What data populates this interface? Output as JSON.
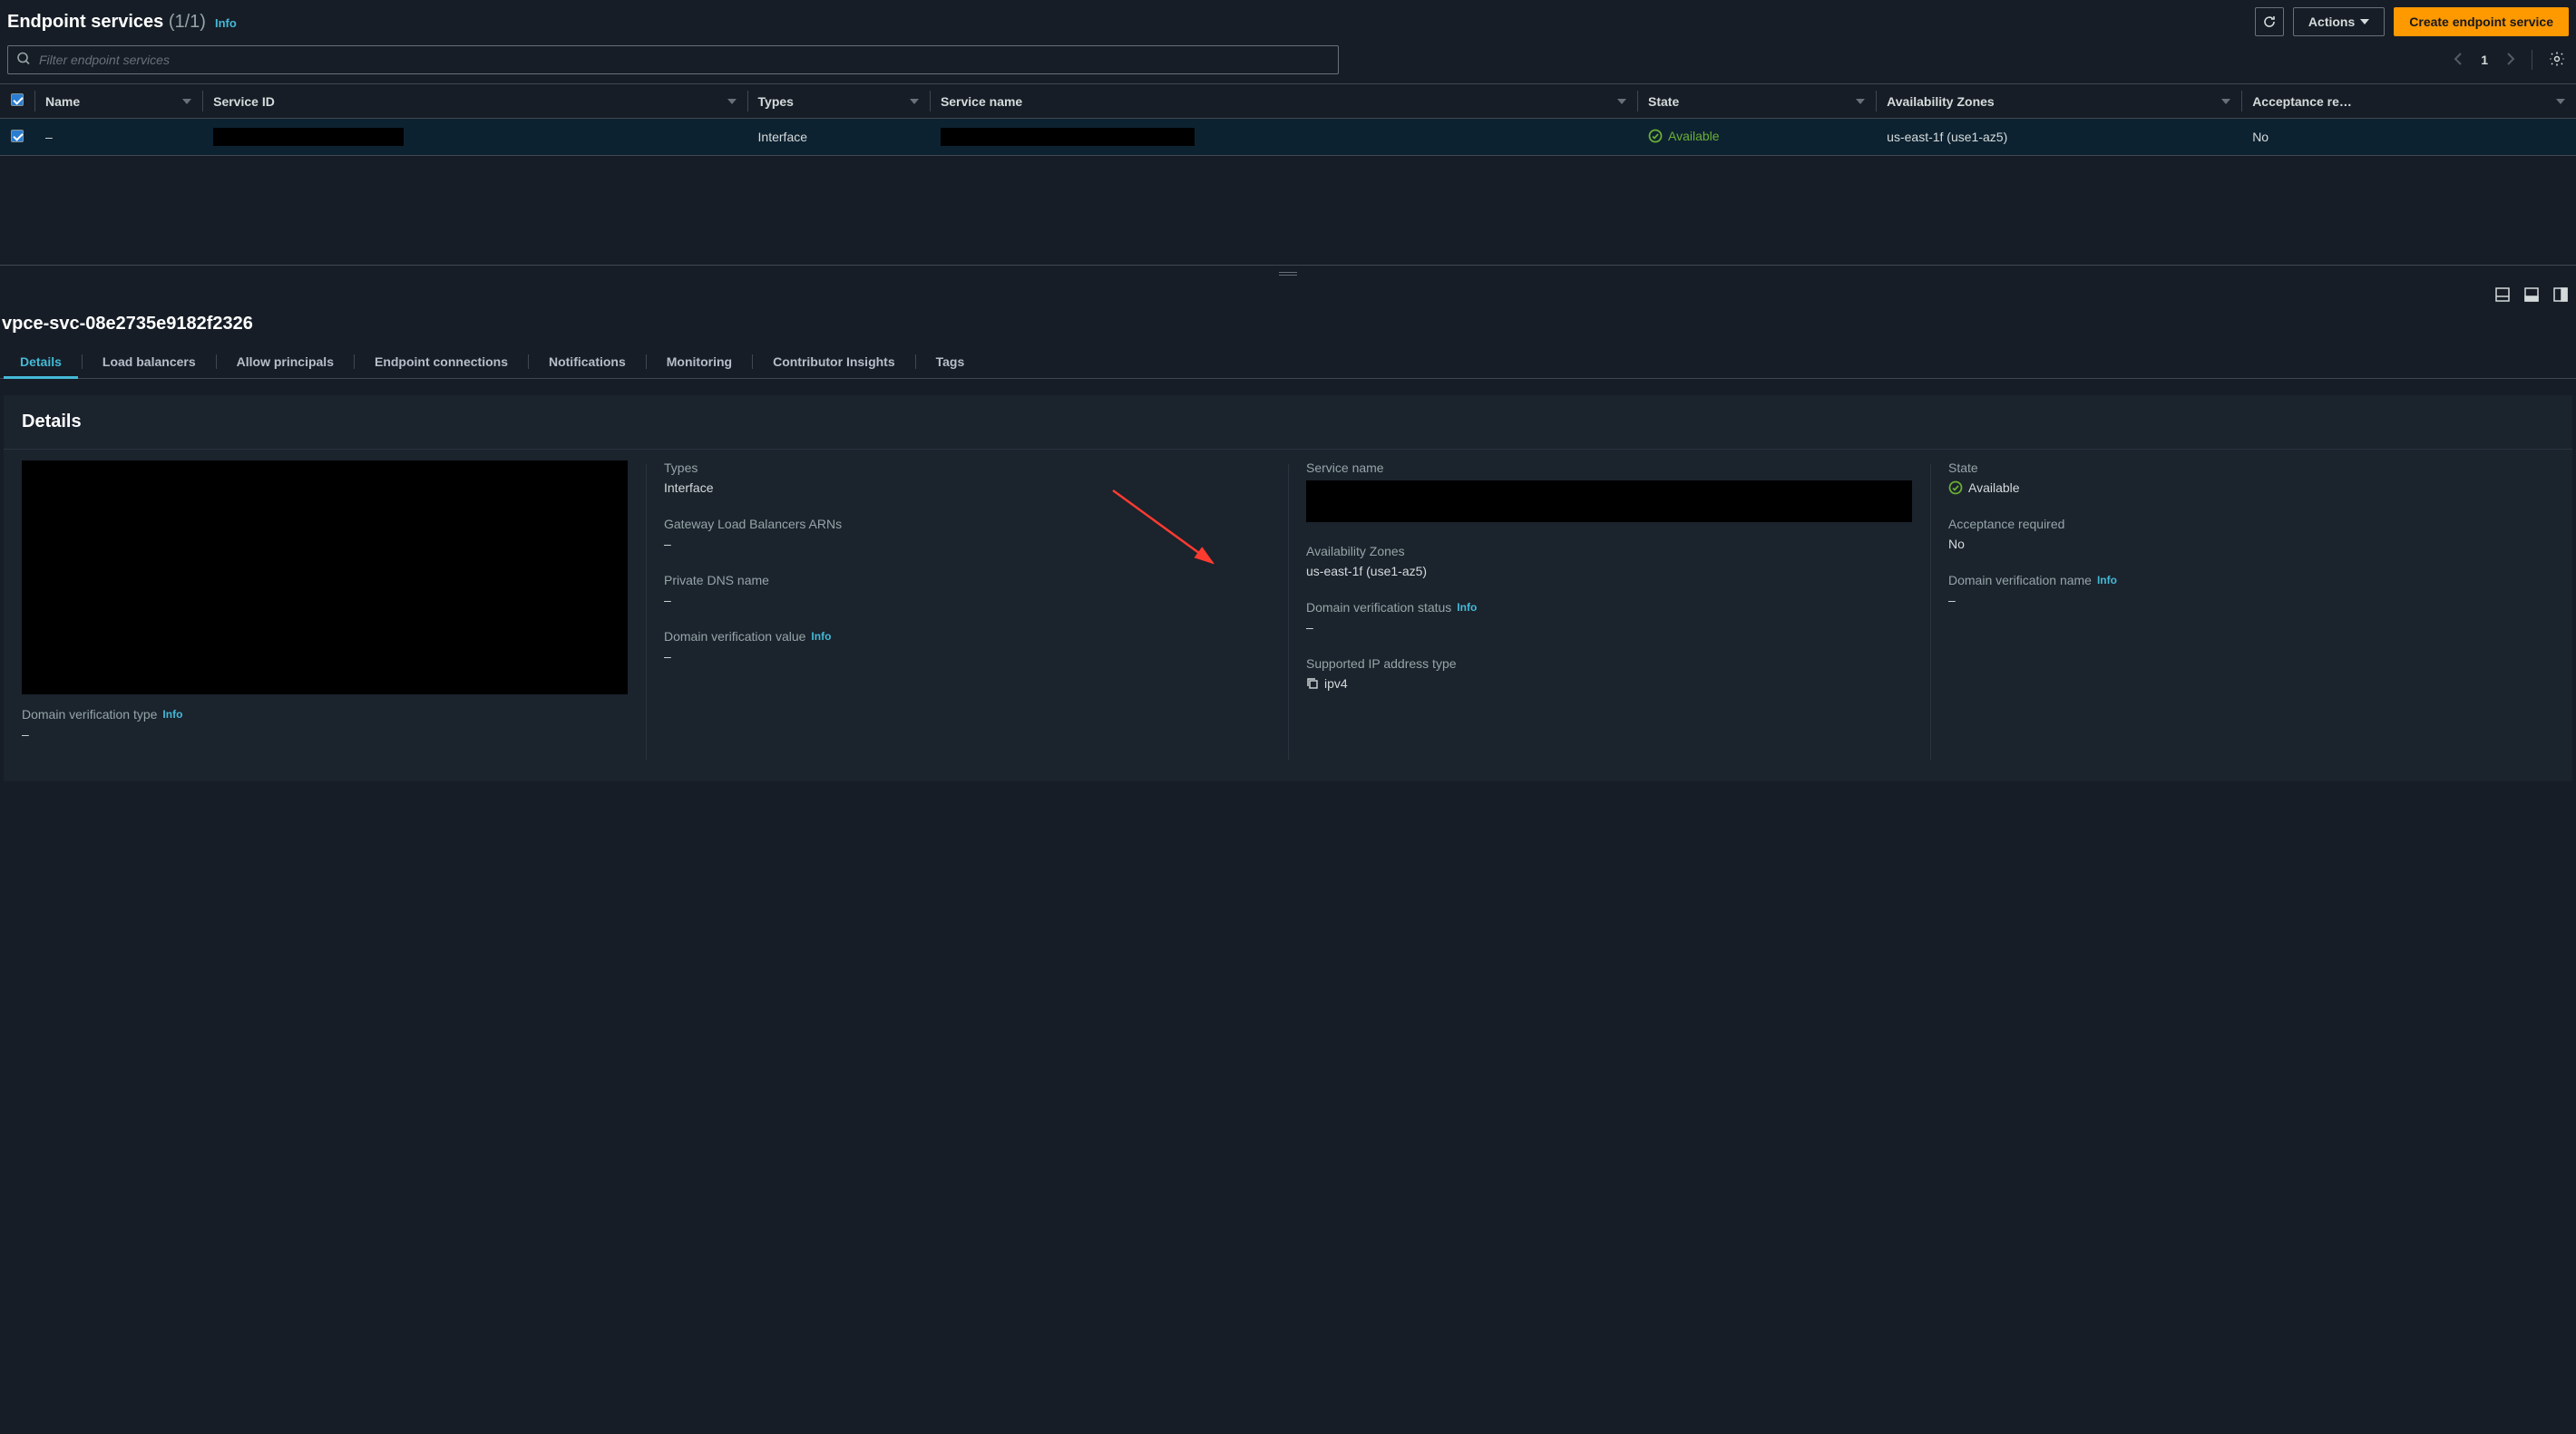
{
  "header": {
    "title": "Endpoint services",
    "count": "(1/1)",
    "info": "Info",
    "actions_label": "Actions",
    "create_label": "Create endpoint service"
  },
  "search": {
    "placeholder": "Filter endpoint services"
  },
  "pagination": {
    "current": "1"
  },
  "columns": {
    "name": "Name",
    "service_id": "Service ID",
    "types": "Types",
    "service_name": "Service name",
    "state": "State",
    "az": "Availability Zones",
    "acceptance": "Acceptance re…"
  },
  "row": {
    "name": "–",
    "types": "Interface",
    "state": "Available",
    "az": "us-east-1f (use1-az5)",
    "acceptance": "No"
  },
  "detail_header": {
    "id": "vpce-svc-08e2735e9182f2326"
  },
  "tabs": {
    "details": "Details",
    "load_balancers": "Load balancers",
    "allow_principals": "Allow principals",
    "endpoint_connections": "Endpoint connections",
    "notifications": "Notifications",
    "monitoring": "Monitoring",
    "contributor_insights": "Contributor Insights",
    "tags": "Tags"
  },
  "details_card": {
    "title": "Details"
  },
  "fields": {
    "types_label": "Types",
    "types_value": "Interface",
    "glb_label": "Gateway Load Balancers ARNs",
    "glb_value": "–",
    "pdns_label": "Private DNS name",
    "pdns_value": "–",
    "dvv_label": "Domain verification value",
    "dvv_value": "–",
    "dvt_label": "Domain verification type",
    "dvt_value": "–",
    "sn_label": "Service name",
    "az_label": "Availability Zones",
    "az_value": "us-east-1f (use1-az5)",
    "dvs_label": "Domain verification status",
    "dvs_value": "–",
    "ip_label": "Supported IP address type",
    "ip_value": "ipv4",
    "state_label": "State",
    "state_value": "Available",
    "acc_label": "Acceptance required",
    "acc_value": "No",
    "dvn_label": "Domain verification name",
    "dvn_value": "–",
    "info": "Info"
  }
}
